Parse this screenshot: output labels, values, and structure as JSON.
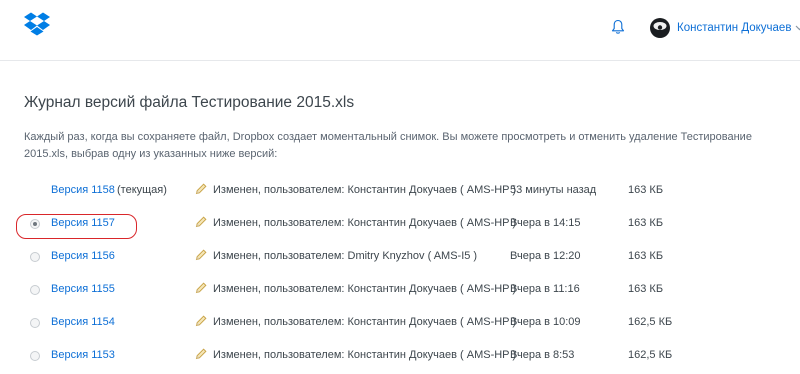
{
  "header": {
    "logo_icon": "dropbox-logo",
    "notification_icon": "bell-icon",
    "user": {
      "name": "Константин Докучаев",
      "avatar_icon": "user-avatar",
      "menu_icon": "chevron-down-icon"
    }
  },
  "page": {
    "title": "Журнал версий файла Тестирование 2015.xls",
    "description": "Каждый раз, когда вы сохраняете файл, Dropbox создает моментальный снимок. Вы можете просмотреть и отменить удаление Тестирование 2015.xls, выбрав одну из указанных ниже версий:"
  },
  "versions": [
    {
      "label": "Версия 1158",
      "current_label": "(текущая)",
      "editor": "Изменен, пользователем: Константин Докучаев ( AMS-HP )",
      "time": "53 минуты назад",
      "size": "163 КБ",
      "selected": false,
      "is_current": true
    },
    {
      "label": "Версия 1157",
      "editor": "Изменен, пользователем: Константин Докучаев ( AMS-HP )",
      "time": "Вчера в 14:15",
      "size": "163 КБ",
      "selected": true,
      "is_current": false
    },
    {
      "label": "Версия 1156",
      "editor": "Изменен, пользователем: Dmitry Knyzhov ( AMS-I5 )",
      "time": "Вчера в 12:20",
      "size": "163 КБ",
      "selected": false,
      "is_current": false
    },
    {
      "label": "Версия 1155",
      "editor": "Изменен, пользователем: Константин Докучаев ( AMS-HP )",
      "time": "Вчера в 11:16",
      "size": "163 КБ",
      "selected": false,
      "is_current": false
    },
    {
      "label": "Версия 1154",
      "editor": "Изменен, пользователем: Константин Докучаев ( AMS-HP )",
      "time": "Вчера в 10:09",
      "size": "162,5 КБ",
      "selected": false,
      "is_current": false
    },
    {
      "label": "Версия 1153",
      "editor": "Изменен, пользователем: Константин Докучаев ( AMS-HP )",
      "time": "Вчера в 8:53",
      "size": "162,5 КБ",
      "selected": false,
      "is_current": false
    }
  ],
  "colors": {
    "link": "#0d6fd6",
    "dropbox_blue": "#007ee5",
    "highlight": "#d9262a",
    "pencil": "#c9a54a"
  }
}
